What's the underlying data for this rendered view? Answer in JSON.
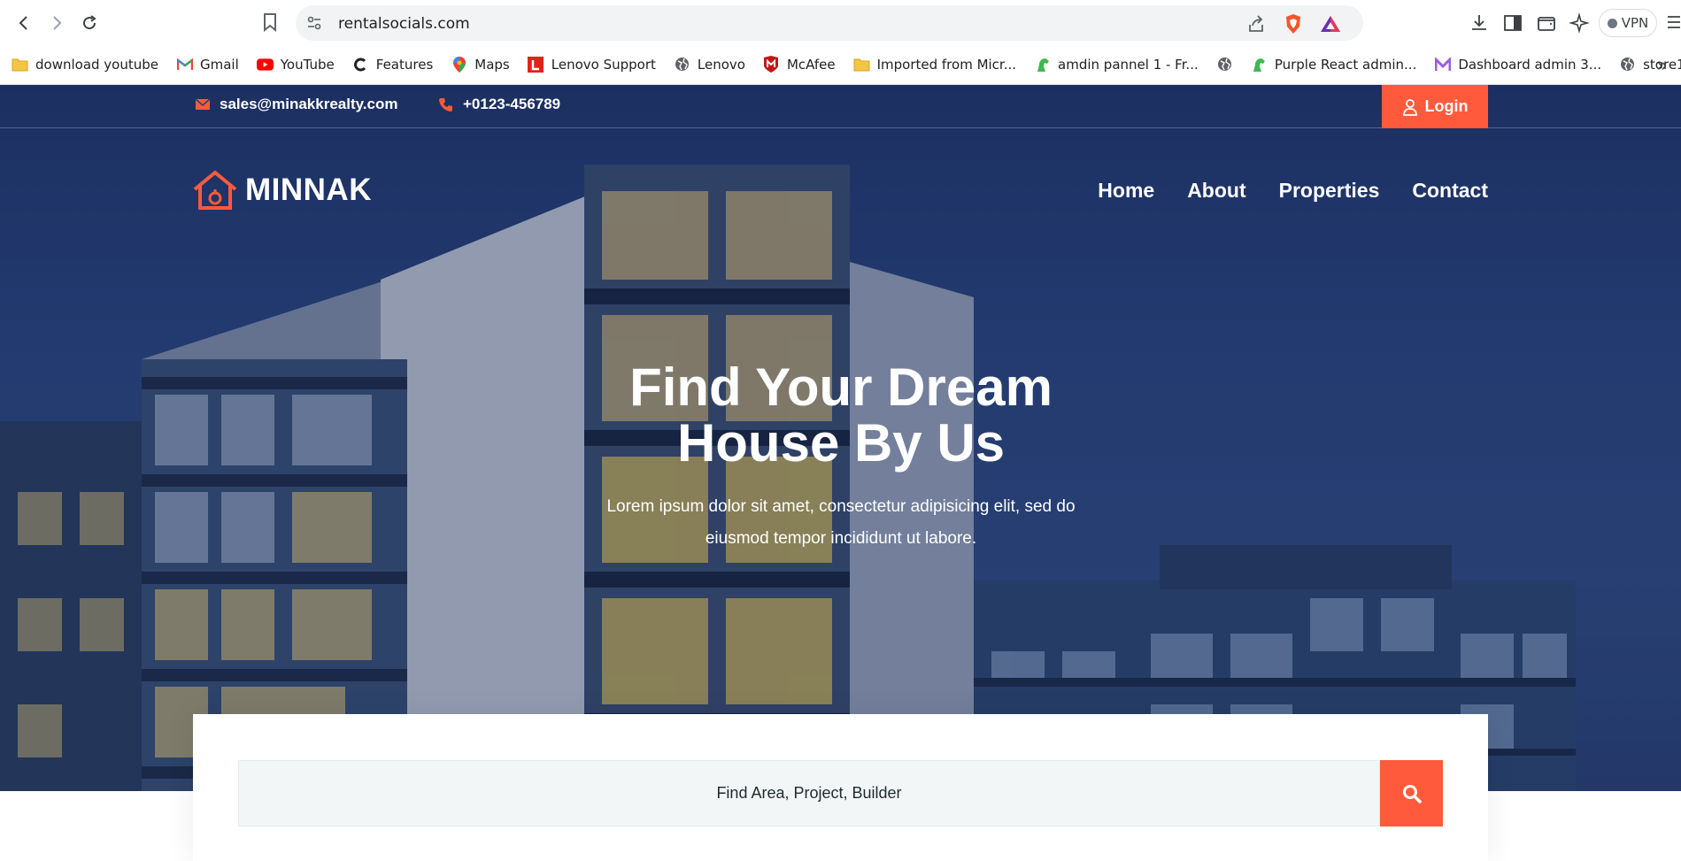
{
  "browser": {
    "url": "rentalsocials.com",
    "vpn_label": "VPN",
    "bookmarks": [
      {
        "label": "download youtube",
        "icon": "folder-icon"
      },
      {
        "label": "Gmail",
        "icon": "gmail-icon"
      },
      {
        "label": "YouTube",
        "icon": "youtube-icon"
      },
      {
        "label": "Features",
        "icon": "features-icon"
      },
      {
        "label": "Maps",
        "icon": "maps-icon"
      },
      {
        "label": "Lenovo Support",
        "icon": "lenovo-support-icon"
      },
      {
        "label": "Lenovo",
        "icon": "globe-icon"
      },
      {
        "label": "McAfee",
        "icon": "mcafee-icon"
      },
      {
        "label": "Imported from Micr...",
        "icon": "folder-icon"
      },
      {
        "label": "amdin pannel 1 - Fr...",
        "icon": "horse-icon"
      },
      {
        "label": "",
        "icon": "globe-icon"
      },
      {
        "label": "Purple React admin...",
        "icon": "horse-icon"
      },
      {
        "label": "Dashboard admin 3...",
        "icon": "m-logo-icon"
      },
      {
        "label": "store1",
        "icon": "globe-icon"
      }
    ]
  },
  "topbar": {
    "email": "sales@minakkrealty.com",
    "phone": "+0123-456789",
    "login_label": "Login"
  },
  "brand": {
    "name": "MINNAK",
    "accent": "#ff5a3c"
  },
  "nav": {
    "items": [
      "Home",
      "About",
      "Properties",
      "Contact"
    ]
  },
  "hero": {
    "title_line1": "Find Your Dream",
    "title_line2": "House By Us",
    "subtitle_line1": "Lorem ipsum dolor sit amet, consectetur adipisicing elit, sed do",
    "subtitle_line2": "eiusmod tempor incididunt ut labore."
  },
  "search": {
    "placeholder": "Find Area, Project, Builder"
  }
}
